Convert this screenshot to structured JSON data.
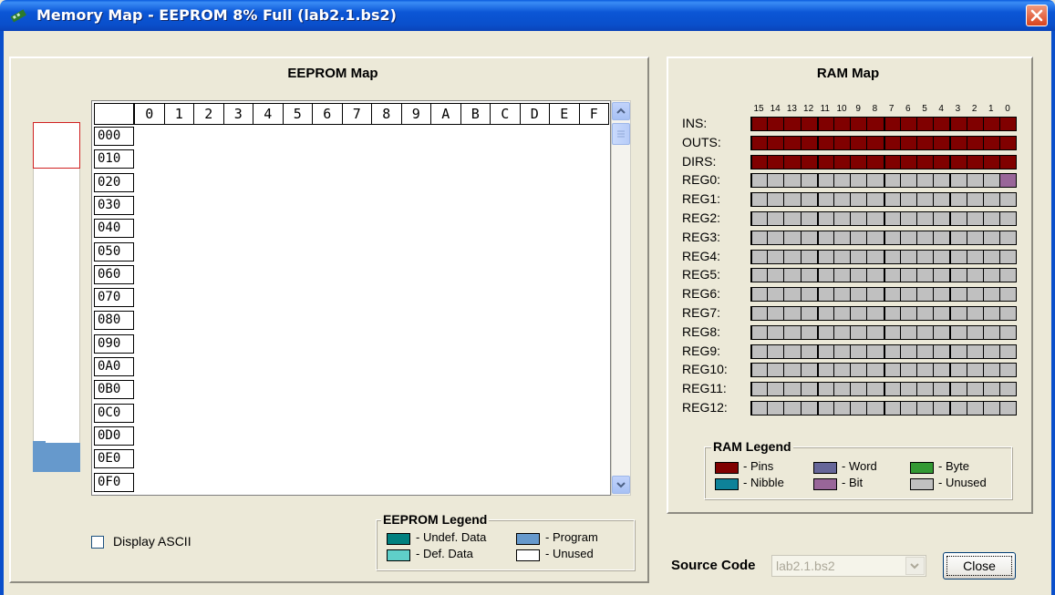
{
  "window": {
    "title": "Memory Map - EEPROM 8% Full (lab2.1.bs2)"
  },
  "eeprom": {
    "heading": "EEPROM Map",
    "columns": [
      "0",
      "1",
      "2",
      "3",
      "4",
      "5",
      "6",
      "7",
      "8",
      "9",
      "A",
      "B",
      "C",
      "D",
      "E",
      "F"
    ],
    "rows": [
      "000",
      "010",
      "020",
      "030",
      "040",
      "050",
      "060",
      "070",
      "080",
      "090",
      "0A0",
      "0B0",
      "0C0",
      "0D0",
      "0E0",
      "0F0"
    ],
    "display_ascii_label": "Display ASCII",
    "display_ascii_checked": false,
    "legend": {
      "title": "EEPROM Legend",
      "items": [
        {
          "label": "- Undef. Data",
          "color": "#00807F"
        },
        {
          "label": "- Program",
          "color": "#6699CC"
        },
        {
          "label": "- Def. Data",
          "color": "#5FCFC9"
        },
        {
          "label": "- Unused",
          "color": "#FFFFFF"
        }
      ]
    },
    "fill_percent": 8
  },
  "ram": {
    "heading": "RAM Map",
    "bit_numbers": [
      "15",
      "14",
      "13",
      "12",
      "11",
      "10",
      "9",
      "8",
      "7",
      "6",
      "5",
      "4",
      "3",
      "2",
      "1",
      "0"
    ],
    "rows": [
      {
        "label": "INS:",
        "type": "pins"
      },
      {
        "label": "OUTS:",
        "type": "pins"
      },
      {
        "label": "DIRS:",
        "type": "pins"
      },
      {
        "label": "REG0:",
        "type": "reg0"
      },
      {
        "label": "REG1:",
        "type": "unused"
      },
      {
        "label": "REG2:",
        "type": "unused"
      },
      {
        "label": "REG3:",
        "type": "unused"
      },
      {
        "label": "REG4:",
        "type": "unused"
      },
      {
        "label": "REG5:",
        "type": "unused"
      },
      {
        "label": "REG6:",
        "type": "unused"
      },
      {
        "label": "REG7:",
        "type": "unused"
      },
      {
        "label": "REG8:",
        "type": "unused"
      },
      {
        "label": "REG9:",
        "type": "unused"
      },
      {
        "label": "REG10:",
        "type": "unused"
      },
      {
        "label": "REG11:",
        "type": "unused"
      },
      {
        "label": "REG12:",
        "type": "unused"
      }
    ],
    "legend": {
      "title": "RAM Legend",
      "items": [
        {
          "label": "- Pins",
          "color": "#800000"
        },
        {
          "label": "- Word",
          "color": "#666699"
        },
        {
          "label": "- Byte",
          "color": "#339933"
        },
        {
          "label": "- Nibble",
          "color": "#0E8299"
        },
        {
          "label": "- Bit",
          "color": "#996699"
        },
        {
          "label": "- Unused",
          "color": "#C0C0C0"
        }
      ]
    }
  },
  "footer": {
    "source_code_label": "Source Code",
    "source_code_value": "lab2.1.bs2",
    "close_label": "Close"
  }
}
